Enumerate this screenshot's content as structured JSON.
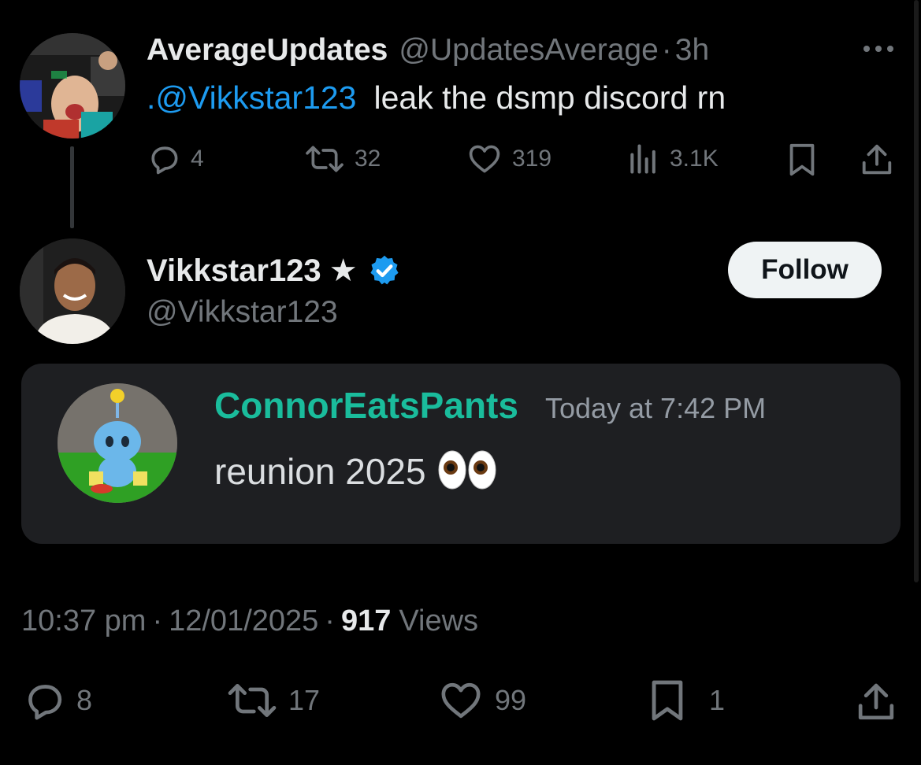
{
  "parent_tweet": {
    "display_name": "AverageUpdates",
    "handle": "@UpdatesAverage",
    "separator": "·",
    "time": "3h",
    "mention": ".@Vikkstar123",
    "text": "leak the dsmp discord rn",
    "more_icon": "more-horizontal-icon",
    "actions": {
      "replies": "4",
      "reposts": "32",
      "likes": "319",
      "views": "3.1K"
    }
  },
  "main_tweet": {
    "display_name": "Vikkstar123",
    "star": "★",
    "verified_icon": "verified-badge-icon",
    "handle": "@Vikkstar123",
    "follow_label": "Follow",
    "embedded_message": {
      "username": "ConnorEatsPants",
      "timestamp": "Today at 7:42 PM",
      "text": "reunion 2025",
      "emoji": "👀",
      "username_color": "#1abc9c"
    },
    "meta": {
      "time": "10:37 pm",
      "separator": "·",
      "date": "12/01/2025",
      "separator2": "·",
      "views_count": "917",
      "views_label": "Views"
    },
    "actions": {
      "replies": "8",
      "reposts": "17",
      "likes": "99",
      "bookmarks": "1"
    }
  },
  "colors": {
    "background": "#000000",
    "text": "#e7e9ea",
    "muted": "#71767b",
    "link": "#1d9bf0",
    "card_bg": "#1e1f22"
  }
}
